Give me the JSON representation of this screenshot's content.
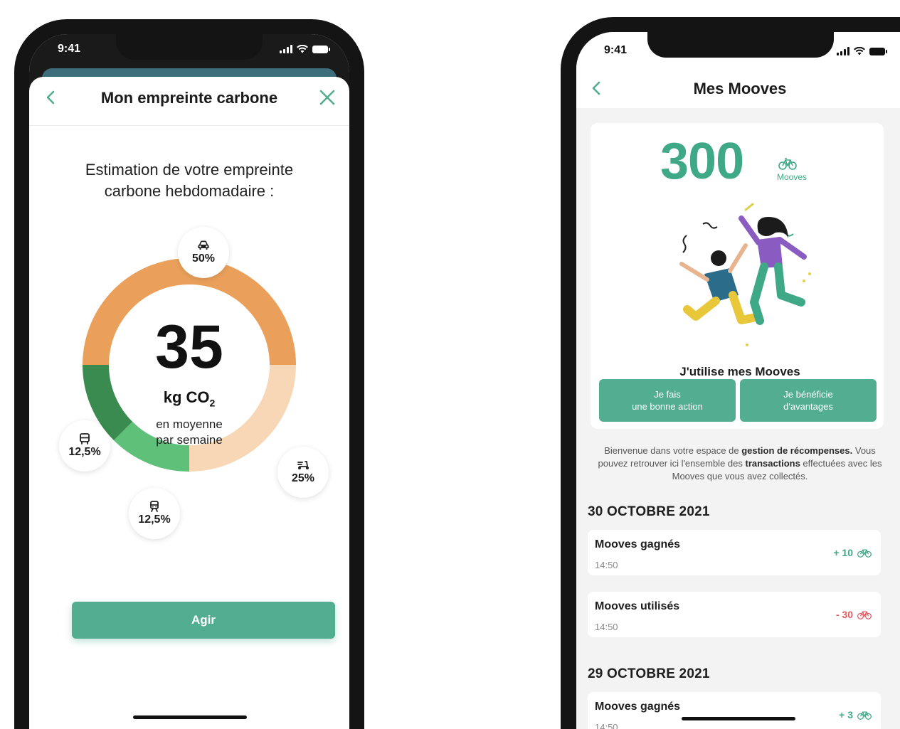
{
  "colors": {
    "accent": "#52ad91",
    "accent_text": "#3ea887",
    "car": "#eaa05a",
    "scooter": "#f7d7b5",
    "train": "#5fc07a",
    "bus": "#3a8b4f",
    "negative": "#e05a60"
  },
  "phone1": {
    "status": {
      "time": "9:41"
    },
    "nav": {
      "title": "Mon empreinte carbone",
      "back_icon": "chevron-left-icon",
      "close_icon": "close-icon"
    },
    "heading": "Estimation de votre empreinte carbone hebdomadaire :",
    "center": {
      "value": "35",
      "unit": "kg CO",
      "unit_sub": "2",
      "line1": "en moyenne",
      "line2": "par semaine"
    },
    "segments": [
      {
        "name": "car",
        "icon": "car-icon",
        "label": "50%",
        "percent": 50
      },
      {
        "name": "scooter",
        "icon": "scooter-icon",
        "label": "25%",
        "percent": 25
      },
      {
        "name": "train",
        "icon": "train-icon",
        "label": "12,5%",
        "percent": 12.5
      },
      {
        "name": "bus",
        "icon": "bus-icon",
        "label": "12,5%",
        "percent": 12.5
      }
    ],
    "action_button": "Agir"
  },
  "phone2": {
    "status": {
      "time": "9:41"
    },
    "nav": {
      "title": "Mes Mooves",
      "back_icon": "chevron-left-icon"
    },
    "balance": {
      "value": "300",
      "unit": "Mooves",
      "icon": "bike-icon"
    },
    "use_title": "J'utilise mes Mooves",
    "buttons": [
      {
        "line1": "Je fais",
        "line2": "une bonne action"
      },
      {
        "line1": "Je bénéficie",
        "line2": "d'avantages"
      }
    ],
    "welcome": {
      "part1": "Bienvenue dans votre espace de ",
      "bold1": "gestion de récompenses.",
      "part2": " Vous pouvez retrouver ici l'ensemble des ",
      "bold2": "transactions",
      "part3": " effectuées avec les Mooves que vous avez collectés."
    },
    "groups": [
      {
        "date": "30 OCTOBRE 2021",
        "items": [
          {
            "label": "Mooves gagnés",
            "time": "14:50",
            "amount": "+ 10",
            "type": "gain"
          },
          {
            "label": "Mooves utilisés",
            "time": "14:50",
            "amount": "- 30",
            "type": "spend"
          }
        ]
      },
      {
        "date": "29 OCTOBRE 2021",
        "items": [
          {
            "label": "Mooves gagnés",
            "time": "14:50",
            "amount": "+ 3",
            "type": "gain"
          }
        ]
      }
    ]
  }
}
